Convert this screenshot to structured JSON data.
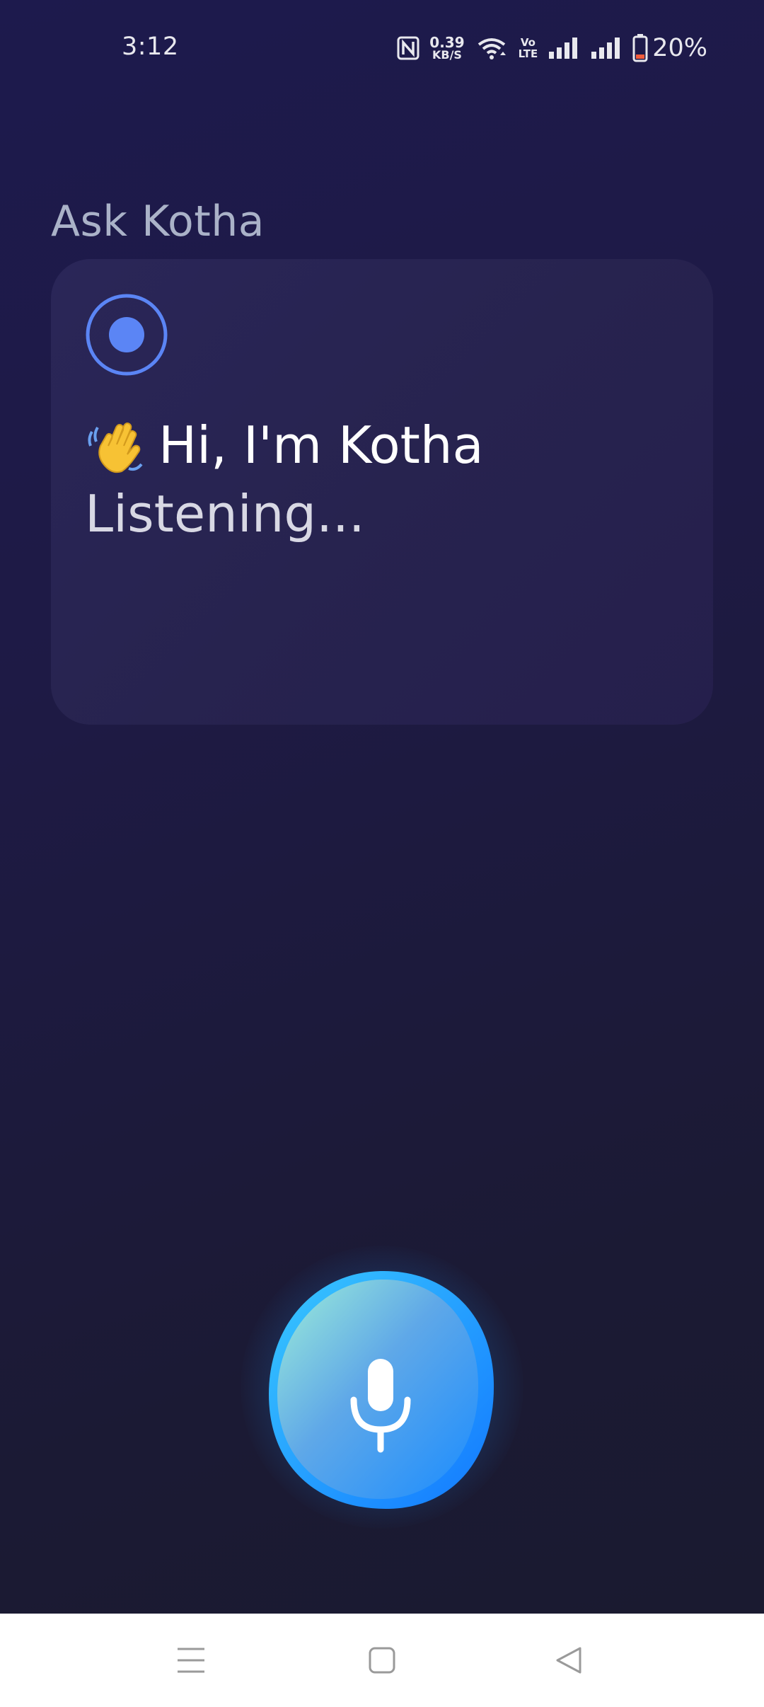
{
  "status_bar": {
    "time": "3:12",
    "net_speed_value": "0.39",
    "net_speed_unit": "KB/S",
    "volte_top": "Vo",
    "volte_bottom": "LTE",
    "battery": "20%"
  },
  "header": {
    "title": "Ask Kotha"
  },
  "card": {
    "indicator_icon": "record-dot-icon",
    "greeting_emoji": "waving-hand-icon",
    "greeting": "Hi, I'm Kotha",
    "status": "Listening..."
  },
  "mic": {
    "icon": "microphone-icon",
    "colors": {
      "start": "#8fe3d6",
      "end": "#1e90ff"
    }
  },
  "nav_bar": {
    "menu_icon": "menu-icon",
    "home_icon": "home-icon",
    "back_icon": "back-icon"
  },
  "colors": {
    "background": "#1d1a44",
    "card": "#28244f",
    "indicator": "#5b85f5",
    "title": "#aab2c8"
  }
}
